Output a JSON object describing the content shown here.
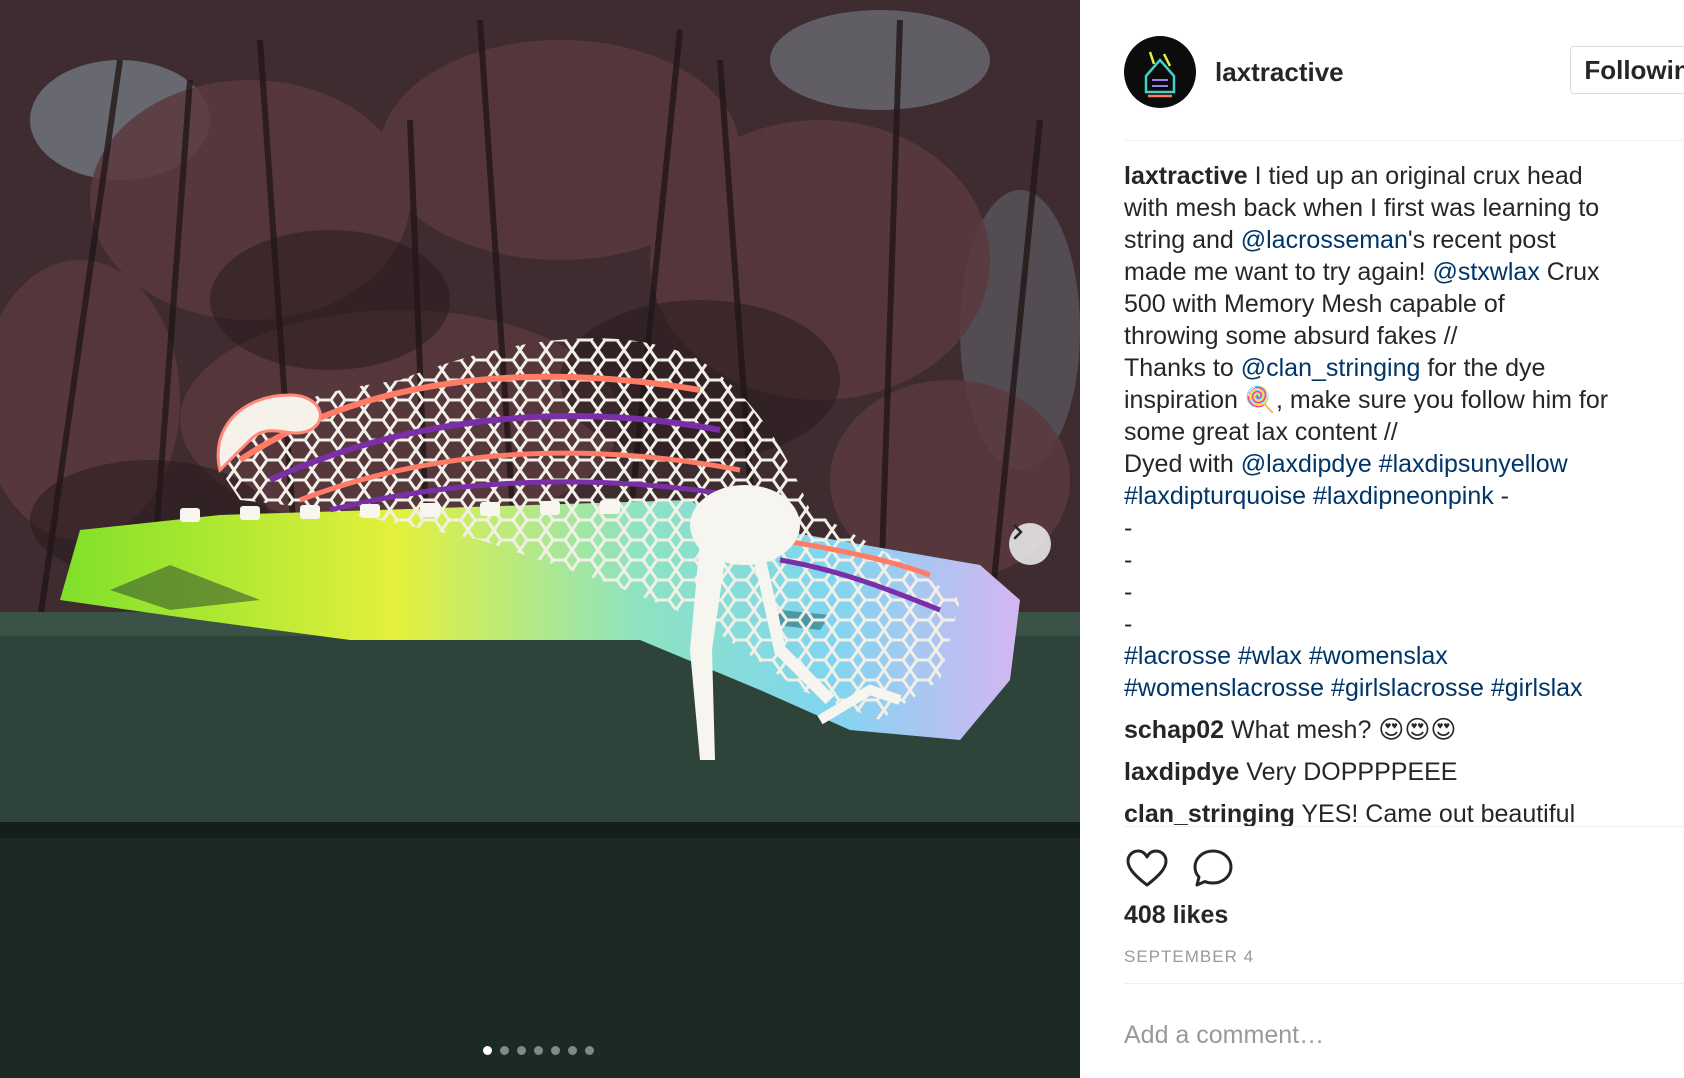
{
  "post": {
    "photo_description_icon": "lacrosse-head-photo",
    "carousel": {
      "total": 7,
      "active_index": 0
    }
  },
  "header": {
    "username": "laxtractive",
    "follow_label": "Following"
  },
  "caption": {
    "author": "laxtractive",
    "lines": [
      [
        {
          "t": "I tied up an original crux head"
        }
      ],
      [
        {
          "t": "with mesh back when I first was learning to"
        }
      ],
      [
        {
          "t": "string and "
        },
        {
          "t": "@lacrosseman",
          "link": true
        },
        {
          "t": "'s recent post"
        }
      ],
      [
        {
          "t": "made me want to try again! "
        },
        {
          "t": "@stxwlax",
          "link": true
        },
        {
          "t": " Crux"
        }
      ],
      [
        {
          "t": "500 with Memory Mesh capable of"
        }
      ],
      [
        {
          "t": "throwing some absurd fakes //"
        }
      ],
      [
        {
          "t": "Thanks to "
        },
        {
          "t": "@clan_stringing",
          "link": true
        },
        {
          "t": " for the dye"
        }
      ],
      [
        {
          "t": "inspiration 🍭, make sure you follow him for"
        }
      ],
      [
        {
          "t": "some great lax content //"
        }
      ],
      [
        {
          "t": "Dyed with "
        },
        {
          "t": "@laxdipdye",
          "link": true
        },
        {
          "t": " "
        },
        {
          "t": "#laxdipsunyellow",
          "link": true
        }
      ],
      [
        {
          "t": "#laxdipturquoise",
          "link": true
        },
        {
          "t": " "
        },
        {
          "t": "#laxdipneonpink",
          "link": true
        },
        {
          "t": " -"
        }
      ],
      [
        {
          "t": "-"
        }
      ],
      [
        {
          "t": "-"
        }
      ],
      [
        {
          "t": "-"
        }
      ],
      [
        {
          "t": "-"
        }
      ],
      [
        {
          "t": "#lacrosse",
          "link": true
        },
        {
          "t": " "
        },
        {
          "t": "#wlax",
          "link": true
        },
        {
          "t": " "
        },
        {
          "t": "#womenslax",
          "link": true
        }
      ],
      [
        {
          "t": "#womenslacrosse",
          "link": true
        },
        {
          "t": " "
        },
        {
          "t": "#girlslacrosse",
          "link": true
        },
        {
          "t": " "
        },
        {
          "t": "#girlslax",
          "link": true
        }
      ]
    ]
  },
  "comments": [
    {
      "user": "schap02",
      "text": "What mesh? 😍😍😍"
    },
    {
      "user": "laxdipdye",
      "text": "Very DOPPPPEEE"
    },
    {
      "user": "clan_stringing",
      "text": "YES! Came out beautiful"
    }
  ],
  "actions": {
    "like_icon": "heart-icon",
    "comment_icon": "comment-bubble-icon"
  },
  "likes": "408 likes",
  "date": "SEPTEMBER 4",
  "comment_box": {
    "placeholder": "Add a comment…",
    "more_icon": "more-options-icon"
  }
}
